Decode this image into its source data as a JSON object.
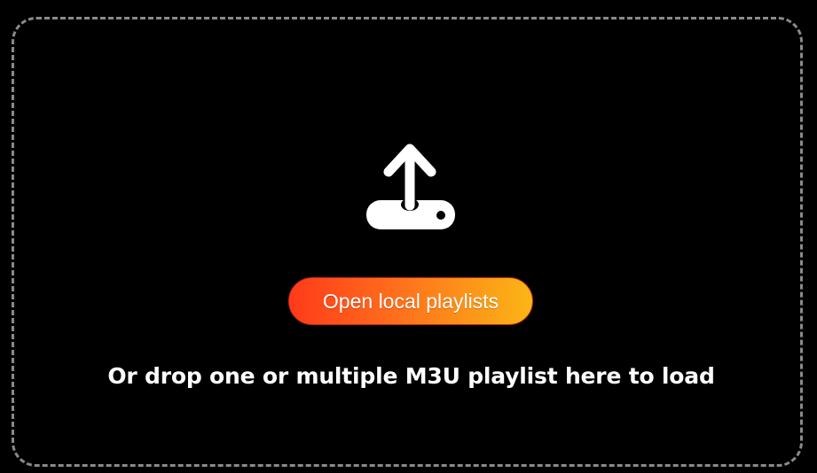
{
  "dropzone": {
    "icon": "upload-icon",
    "button_label": "Open local playlists",
    "hint_text": "Or drop one or multiple M3U playlist here to load"
  },
  "colors": {
    "background": "#000000",
    "border": "#8a8a8a",
    "button_gradient_start": "#ff3a1a",
    "button_gradient_end": "#fbb616",
    "text": "#ffffff"
  }
}
